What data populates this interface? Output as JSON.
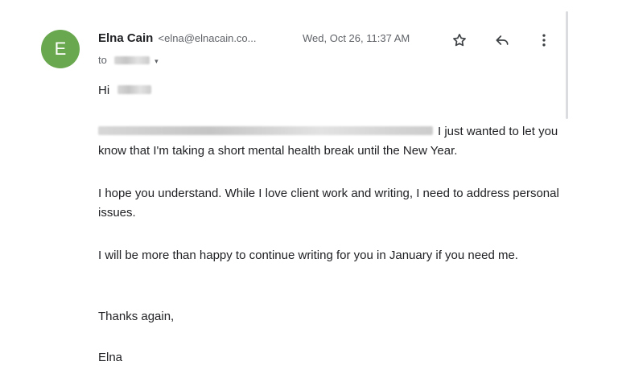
{
  "email": {
    "avatar_letter": "E",
    "avatar_color": "#6aa84f",
    "sender_name": "Elna Cain",
    "sender_email": "<elna@elnacain.co...",
    "date": "Wed, Oct 26, 11:37 AM",
    "recipient_prefix": "to",
    "icons": {
      "star": "star-icon",
      "reply": "reply-icon",
      "more": "more-vert-icon",
      "dropdown": "chevron-down-icon"
    }
  },
  "body": {
    "greeting": "Hi",
    "paragraph_1": "I just wanted to let you know that I'm taking a short mental health break until the New Year.",
    "paragraph_2": "I hope you understand. While I love client work and writing, I need to address personal issues.",
    "paragraph_3": "I will be more than happy to continue writing for you in January if you need me.",
    "closing": "Thanks again,",
    "signature": "Elna"
  }
}
